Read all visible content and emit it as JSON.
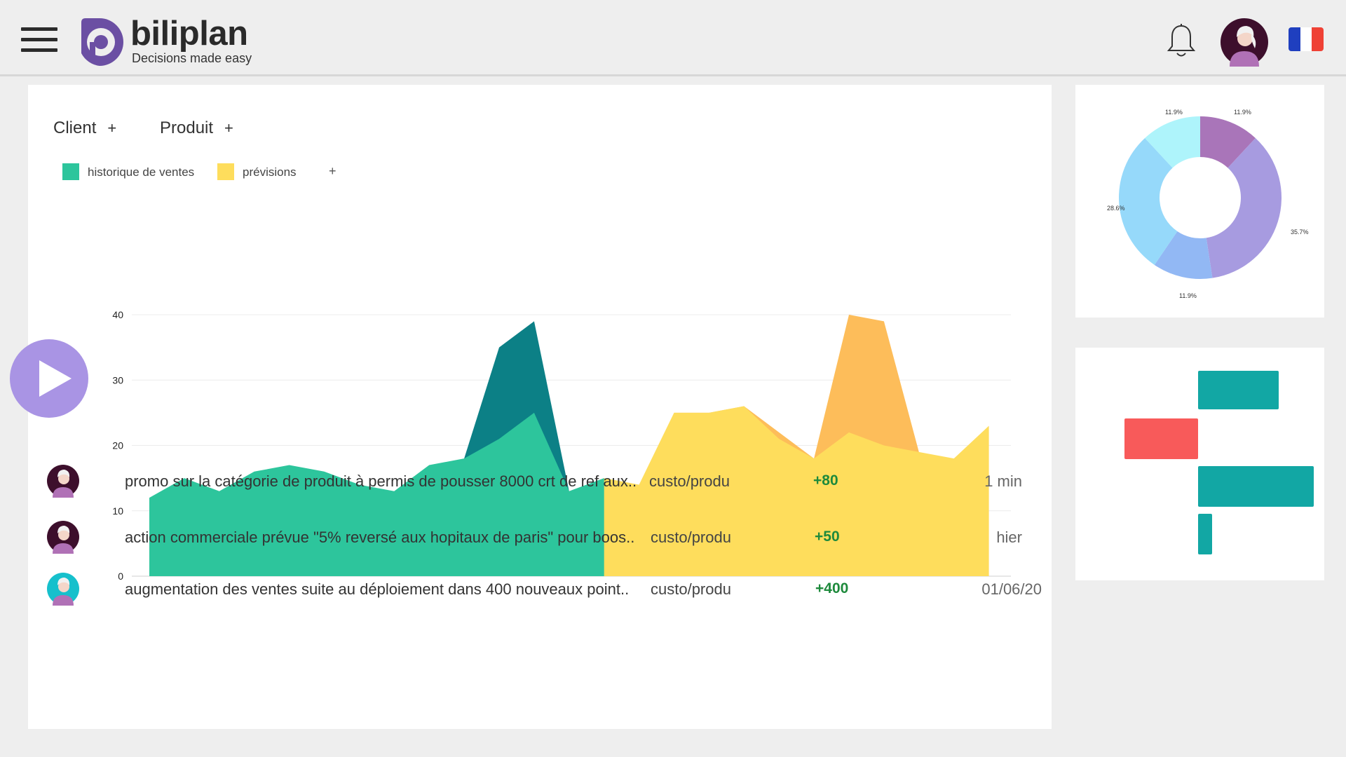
{
  "brand": {
    "name": "biliplan",
    "tagline": "Decisions made easy",
    "colors": {
      "logo": "#6b4fa3",
      "text": "#2a2a2a"
    }
  },
  "header": {
    "menu_icon": "hamburger-menu-icon",
    "notification_icon": "bell-icon",
    "avatar_icon": "user-avatar",
    "language_flag": "flag-france-icon",
    "flag_colors": [
      "#1f3fbf",
      "#ffffff",
      "#ef4135"
    ]
  },
  "filters": [
    {
      "label": "Client",
      "add": "+"
    },
    {
      "label": "Produit",
      "add": "+"
    }
  ],
  "legend": {
    "items": [
      {
        "label": "historique de ventes",
        "color": "#2dc59c"
      },
      {
        "label": "prévisions",
        "color": "#fedd5c"
      }
    ],
    "add": "+"
  },
  "chart_data": {
    "type": "area",
    "y_ticks": [
      "0",
      "10",
      "20",
      "30",
      "40"
    ],
    "ylim": [
      0,
      40
    ],
    "grid": true,
    "series": [
      {
        "name": "historique de ventes",
        "color": "#2dc59c",
        "x": [
          0,
          1,
          2,
          3,
          4,
          5,
          6,
          7,
          8,
          9,
          10,
          11,
          12,
          13,
          14
        ],
        "values": [
          12,
          15,
          13,
          16,
          17,
          16,
          14,
          13,
          17,
          18,
          21,
          25,
          13,
          15,
          0
        ]
      },
      {
        "color": "#0c8086",
        "x": [
          9,
          10,
          11,
          12
        ],
        "values": [
          18,
          35,
          39,
          13
        ]
      },
      {
        "name": "prévisions",
        "color": "#fedd5c",
        "x": [
          13,
          14,
          15,
          16,
          17,
          18,
          19,
          20,
          21,
          22,
          23,
          24
        ],
        "values": [
          15,
          14,
          25,
          25,
          26,
          21,
          18,
          22,
          20,
          19,
          18,
          23
        ]
      },
      {
        "color": "#fdbd5a",
        "x": [
          15,
          16,
          17,
          19,
          20,
          21,
          22
        ],
        "values": [
          25,
          25,
          26,
          18,
          40,
          39,
          19
        ]
      }
    ]
  },
  "side_donut": {
    "type": "pie",
    "labels": [
      "11.9%",
      "35.7%",
      "11.9%",
      "28.6%",
      "11.9%"
    ],
    "values": [
      11.9,
      35.7,
      11.9,
      28.6,
      11.9
    ],
    "colors": [
      "#a975b9",
      "#a79be0",
      "#92b8f4",
      "#96d9fa",
      "#aef4fb"
    ]
  },
  "side_bars": {
    "type": "bar",
    "values": [
      1.15,
      -1.05,
      1.65,
      0.2
    ],
    "colors": [
      "#12a7a4",
      "#f85a5a",
      "#12a7a4",
      "#12a7a4"
    ]
  },
  "activities": [
    {
      "text": "promo sur la catégorie de produit à permis de pousser 8000 crt de ref aux..",
      "tag": "custo/produ",
      "score": "+80",
      "time": "1 min",
      "avatar": "avatar-dark"
    },
    {
      "text": "action commerciale prévue \"5% reversé aux hopitaux de paris\" pour boos..",
      "tag": "custo/produ",
      "score": "+50",
      "time": "hier",
      "avatar": "avatar-dark"
    },
    {
      "text": "augmentation des ventes suite au déploiement dans 400 nouveaux point..",
      "tag": "custo/produ",
      "score": "+400",
      "time": "01/06/20",
      "avatar": "avatar-teal"
    }
  ],
  "play_icon": "play-icon"
}
